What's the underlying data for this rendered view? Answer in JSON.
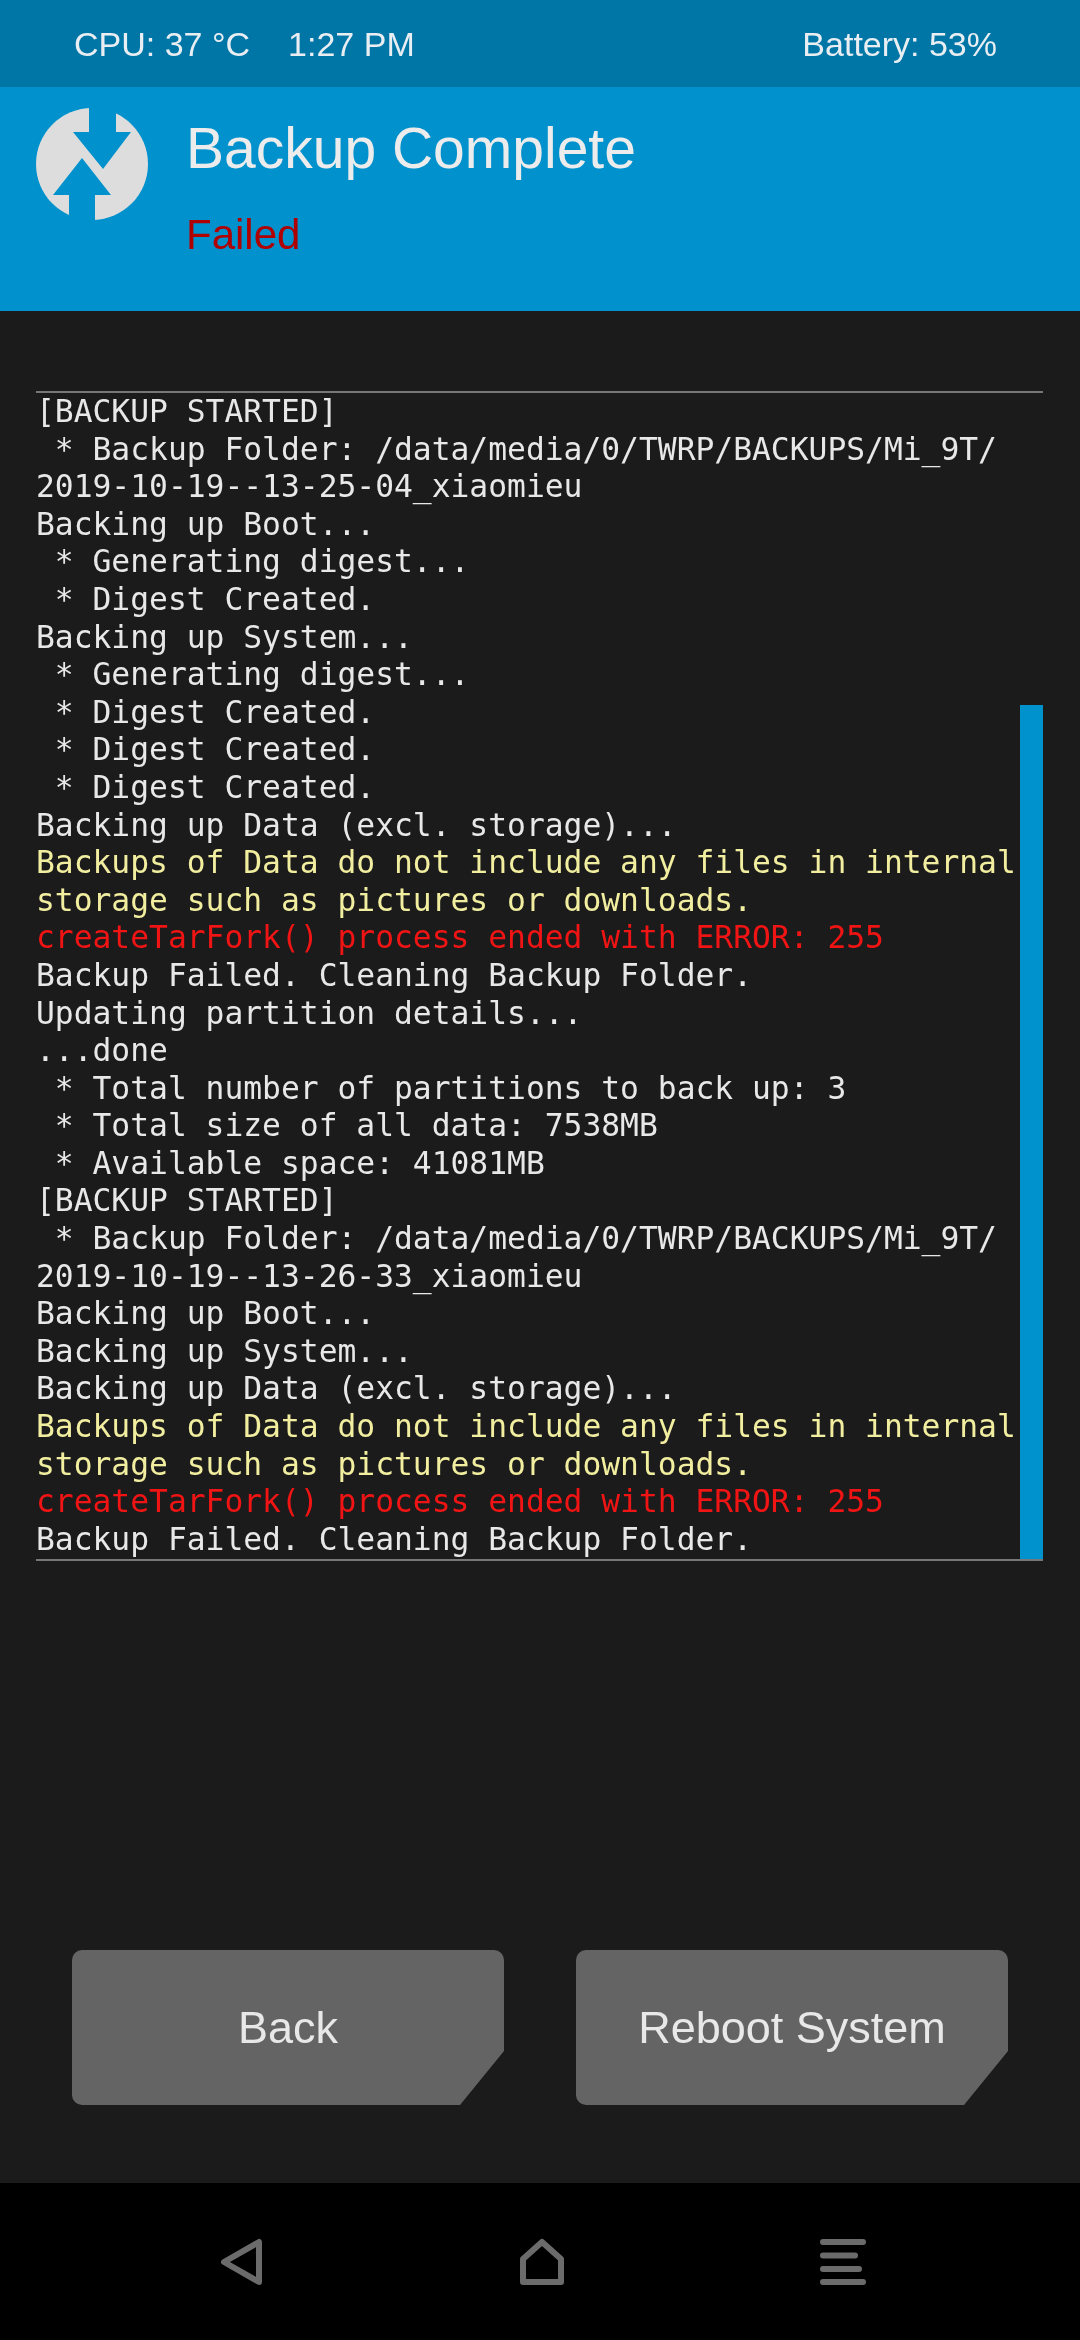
{
  "status_bar": {
    "cpu": "CPU: 37 °C",
    "time": "1:27 PM",
    "battery": "Battery: 53%"
  },
  "header": {
    "title": "Backup Complete",
    "status": "Failed"
  },
  "log": {
    "lines": [
      {
        "text": "[BACKUP STARTED]",
        "kind": "info"
      },
      {
        "text": " * Backup Folder: /data/media/0/TWRP/BACKUPS/Mi_9T/",
        "kind": "info"
      },
      {
        "text": "2019-10-19--13-25-04_xiaomieu",
        "kind": "info"
      },
      {
        "text": "Backing up Boot...",
        "kind": "info"
      },
      {
        "text": " * Generating digest...",
        "kind": "info"
      },
      {
        "text": " * Digest Created.",
        "kind": "info"
      },
      {
        "text": "Backing up System...",
        "kind": "info"
      },
      {
        "text": " * Generating digest...",
        "kind": "info"
      },
      {
        "text": " * Digest Created.",
        "kind": "info"
      },
      {
        "text": " * Digest Created.",
        "kind": "info"
      },
      {
        "text": " * Digest Created.",
        "kind": "info"
      },
      {
        "text": "Backing up Data (excl. storage)...",
        "kind": "info"
      },
      {
        "text": "Backups of Data do not include any files in internal",
        "kind": "warning"
      },
      {
        "text": "storage such as pictures or downloads.",
        "kind": "warning"
      },
      {
        "text": "createTarFork() process ended with ERROR: 255",
        "kind": "error"
      },
      {
        "text": "Backup Failed. Cleaning Backup Folder.",
        "kind": "info"
      },
      {
        "text": "Updating partition details...",
        "kind": "info"
      },
      {
        "text": "...done",
        "kind": "info"
      },
      {
        "text": " * Total number of partitions to back up: 3",
        "kind": "info"
      },
      {
        "text": " * Total size of all data: 7538MB",
        "kind": "info"
      },
      {
        "text": " * Available space: 41081MB",
        "kind": "info"
      },
      {
        "text": "[BACKUP STARTED]",
        "kind": "info"
      },
      {
        "text": " * Backup Folder: /data/media/0/TWRP/BACKUPS/Mi_9T/",
        "kind": "info"
      },
      {
        "text": "2019-10-19--13-26-33_xiaomieu",
        "kind": "info"
      },
      {
        "text": "Backing up Boot...",
        "kind": "info"
      },
      {
        "text": "Backing up System...",
        "kind": "info"
      },
      {
        "text": "Backing up Data (excl. storage)...",
        "kind": "info"
      },
      {
        "text": "Backups of Data do not include any files in internal",
        "kind": "warning"
      },
      {
        "text": "storage such as pictures or downloads.",
        "kind": "warning"
      },
      {
        "text": "createTarFork() process ended with ERROR: 255",
        "kind": "error"
      },
      {
        "text": "Backup Failed. Cleaning Backup Folder.",
        "kind": "info"
      }
    ]
  },
  "buttons": [
    {
      "label": "Back"
    },
    {
      "label": "Reboot System"
    }
  ]
}
